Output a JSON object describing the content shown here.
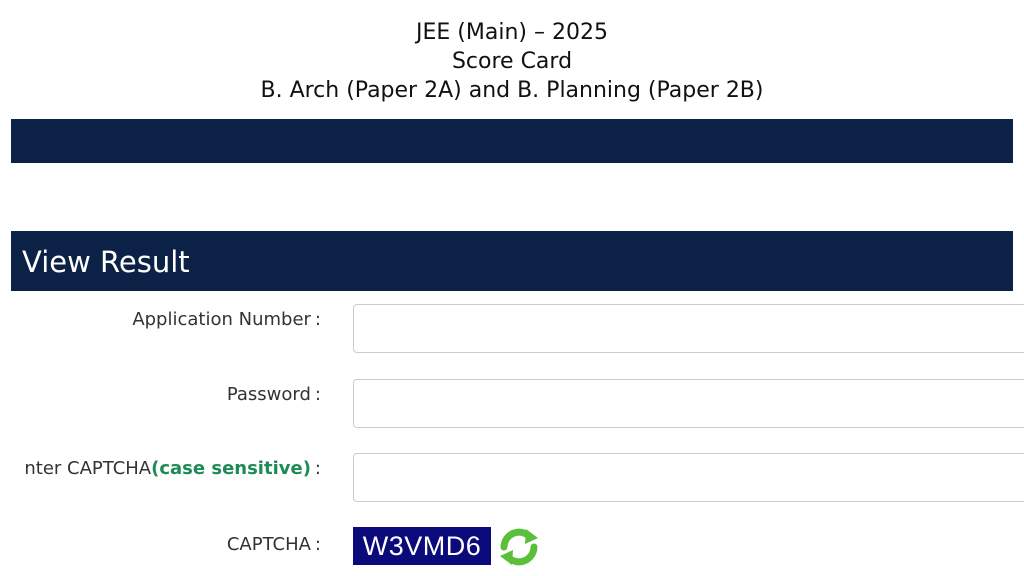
{
  "header": {
    "line1": "JEE (Main) – 2025",
    "line2": "Score Card",
    "line3": "B. Arch (Paper 2A) and B. Planning (Paper 2B)"
  },
  "result": {
    "title": "View Result"
  },
  "form": {
    "application_label": "Application Number",
    "password_label": "Password",
    "captcha_input_label": "nter CAPTCHA",
    "captcha_input_hint": "(case sensitive)",
    "captcha_label": "CAPTCHA",
    "colon": ":",
    "application_value": "",
    "password_value": "",
    "captcha_value": ""
  },
  "captcha": {
    "code": "W3VMD6",
    "refresh_icon": "refresh-icon"
  },
  "colors": {
    "navy": "#0c2146",
    "captcha_bg": "#0a0a7a",
    "hint_green": "#1e8a55",
    "refresh_green": "#5cbf3a"
  }
}
